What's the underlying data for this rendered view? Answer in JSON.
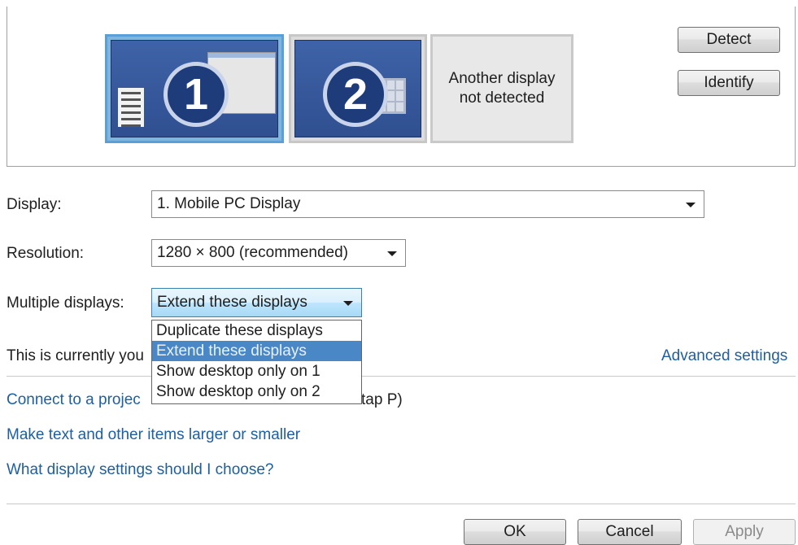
{
  "preview": {
    "monitor1_number": "1",
    "monitor2_number": "2",
    "not_detected_line1": "Another display",
    "not_detected_line2": "not detected",
    "detect_label": "Detect",
    "identify_label": "Identify"
  },
  "form": {
    "display_label": "Display:",
    "display_value": "1. Mobile PC Display",
    "resolution_label": "Resolution:",
    "resolution_value": "1280 × 800 (recommended)",
    "multiple_label": "Multiple displays:",
    "multiple_value": "Extend these displays",
    "multiple_options": [
      "Duplicate these displays",
      "Extend these displays",
      "Show desktop only on 1",
      "Show desktop only on 2"
    ],
    "multiple_selected_index": 1
  },
  "info": {
    "current_text_prefix": "This is currently you",
    "advanced_link": "Advanced settings",
    "projector_link_visible": "Connect to a projec",
    "projector_link_tail": "tap P)",
    "text_size_link": "Make text and other items larger or smaller",
    "help_link": "What display settings should I choose?"
  },
  "buttons": {
    "ok": "OK",
    "cancel": "Cancel",
    "apply": "Apply"
  },
  "colors": {
    "link": "#1d5fa3",
    "selected_option": "#4a87c6",
    "selected_monitor_border": "#5aa0d8"
  }
}
